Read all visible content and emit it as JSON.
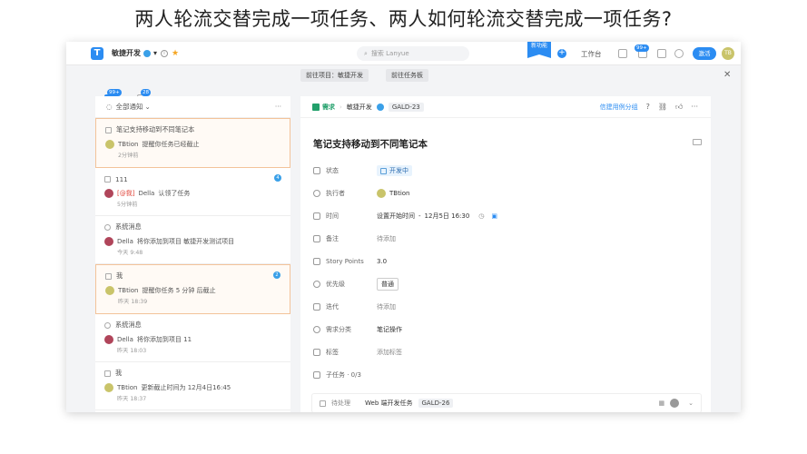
{
  "headline": "两人轮流交替完成一项任务、两人如何轮流交替完成一项任务?",
  "topbar": {
    "logo": "T",
    "project": "敏捷开发",
    "search_placeholder": "搜索 Lanyue",
    "new_badge": "新功能",
    "workbench": "工作台",
    "badge": "99+",
    "upgrade": "激活",
    "avatar": "TB"
  },
  "subbar": {
    "crumb1": "前往项目：敏捷开发",
    "crumb2": "前往任务板"
  },
  "side": {
    "badge1": "99+",
    "badge2": "28"
  },
  "left": {
    "header": "全部通知",
    "cards": [
      {
        "title": "笔记支持移动到不同笔记本",
        "actor": "TBtion",
        "text": "提醒你任务已经截止",
        "time": "2分钟前"
      },
      {
        "title": "111",
        "actor": "Della",
        "prefix": "[@我]",
        "text": "认领了任务",
        "time": "5分钟前",
        "badge": "4"
      },
      {
        "title": "系统消息",
        "actor": "Della",
        "text": "将你添加到项目 敏捷开发测试项目",
        "time": "今天 9:48"
      },
      {
        "title": "我",
        "actor": "TBtion",
        "text": "提醒你任务 5 分钟 后截止",
        "time": "昨天 18:39",
        "badge": "2"
      },
      {
        "title": "系统消息",
        "actor": "Della",
        "text": "将你添加到项目 11",
        "time": "昨天 18:03"
      },
      {
        "title": "我",
        "actor": "TBtion",
        "text": "更新截止时间为 12月4日16:45",
        "time": "昨天 18:37"
      }
    ]
  },
  "right": {
    "type": "需求",
    "project": "敏捷开发",
    "code": "GALD-23",
    "link": "信建用例分组",
    "title": "笔记支持移动到不同笔记本",
    "fields": [
      {
        "label": "状态",
        "value": "开发中"
      },
      {
        "label": "执行者",
        "value": "TBtion"
      },
      {
        "label": "时间",
        "value": "设置开始时间",
        "value2": "12月5日 16:30"
      },
      {
        "label": "备注",
        "value": "待添加"
      },
      {
        "label": "Story Points",
        "value": "3.0"
      },
      {
        "label": "优先级",
        "value": "普通"
      },
      {
        "label": "迭代",
        "value": "待添加"
      },
      {
        "label": "需求分类",
        "value": "笔记操作"
      },
      {
        "label": "标签",
        "value": "添加标签"
      },
      {
        "label": "子任务 · 0/3",
        "value": ""
      }
    ],
    "subtask": {
      "status": "待处理",
      "name": "Web 端开发任务",
      "code": "GALD-26"
    }
  }
}
